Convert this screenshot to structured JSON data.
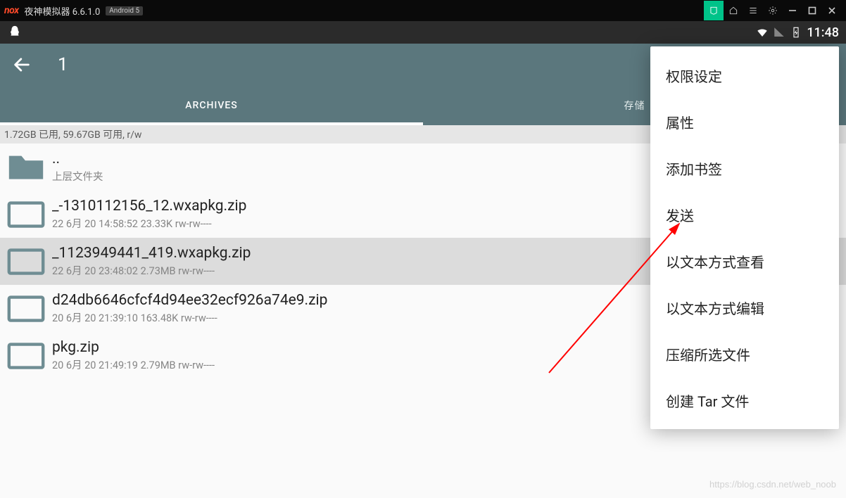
{
  "nox": {
    "logo": "nox",
    "title": "夜神模拟器 6.6.1.0",
    "badge": "Android 5"
  },
  "status": {
    "time": "11:48"
  },
  "header": {
    "title": "1"
  },
  "tabs": {
    "left": "ARCHIVES",
    "right": "存储"
  },
  "info": "1.72GB 已用, 59.67GB 可用, r/w",
  "parent": {
    "name": "..",
    "sub": "上层文件夹"
  },
  "files": [
    {
      "name": "_-1310112156_12.wxapkg.zip",
      "date": "22 6月 20 14:58:52",
      "size": "23.33K",
      "perm": "rw-rw----",
      "sel": false
    },
    {
      "name": "_1123949441_419.wxapkg.zip",
      "date": "22 6月 20 23:48:02",
      "size": "2.73MB",
      "perm": "rw-rw----",
      "sel": true
    },
    {
      "name": "d24db6646cfcf4d94ee32ecf926a74e9.zip",
      "date": "20 6月 20 21:39:10",
      "size": "163.48K",
      "perm": "rw-rw----",
      "sel": false
    },
    {
      "name": "pkg.zip",
      "date": "20 6月 20 21:49:19",
      "size": "2.79MB",
      "perm": "rw-rw----",
      "sel": false
    }
  ],
  "menu": [
    "权限设定",
    "属性",
    "添加书签",
    "发送",
    "以文本方式查看",
    "以文本方式编辑",
    "压缩所选文件",
    "创建 Tar 文件"
  ],
  "watermark": "https://blog.csdn.net/web_noob"
}
